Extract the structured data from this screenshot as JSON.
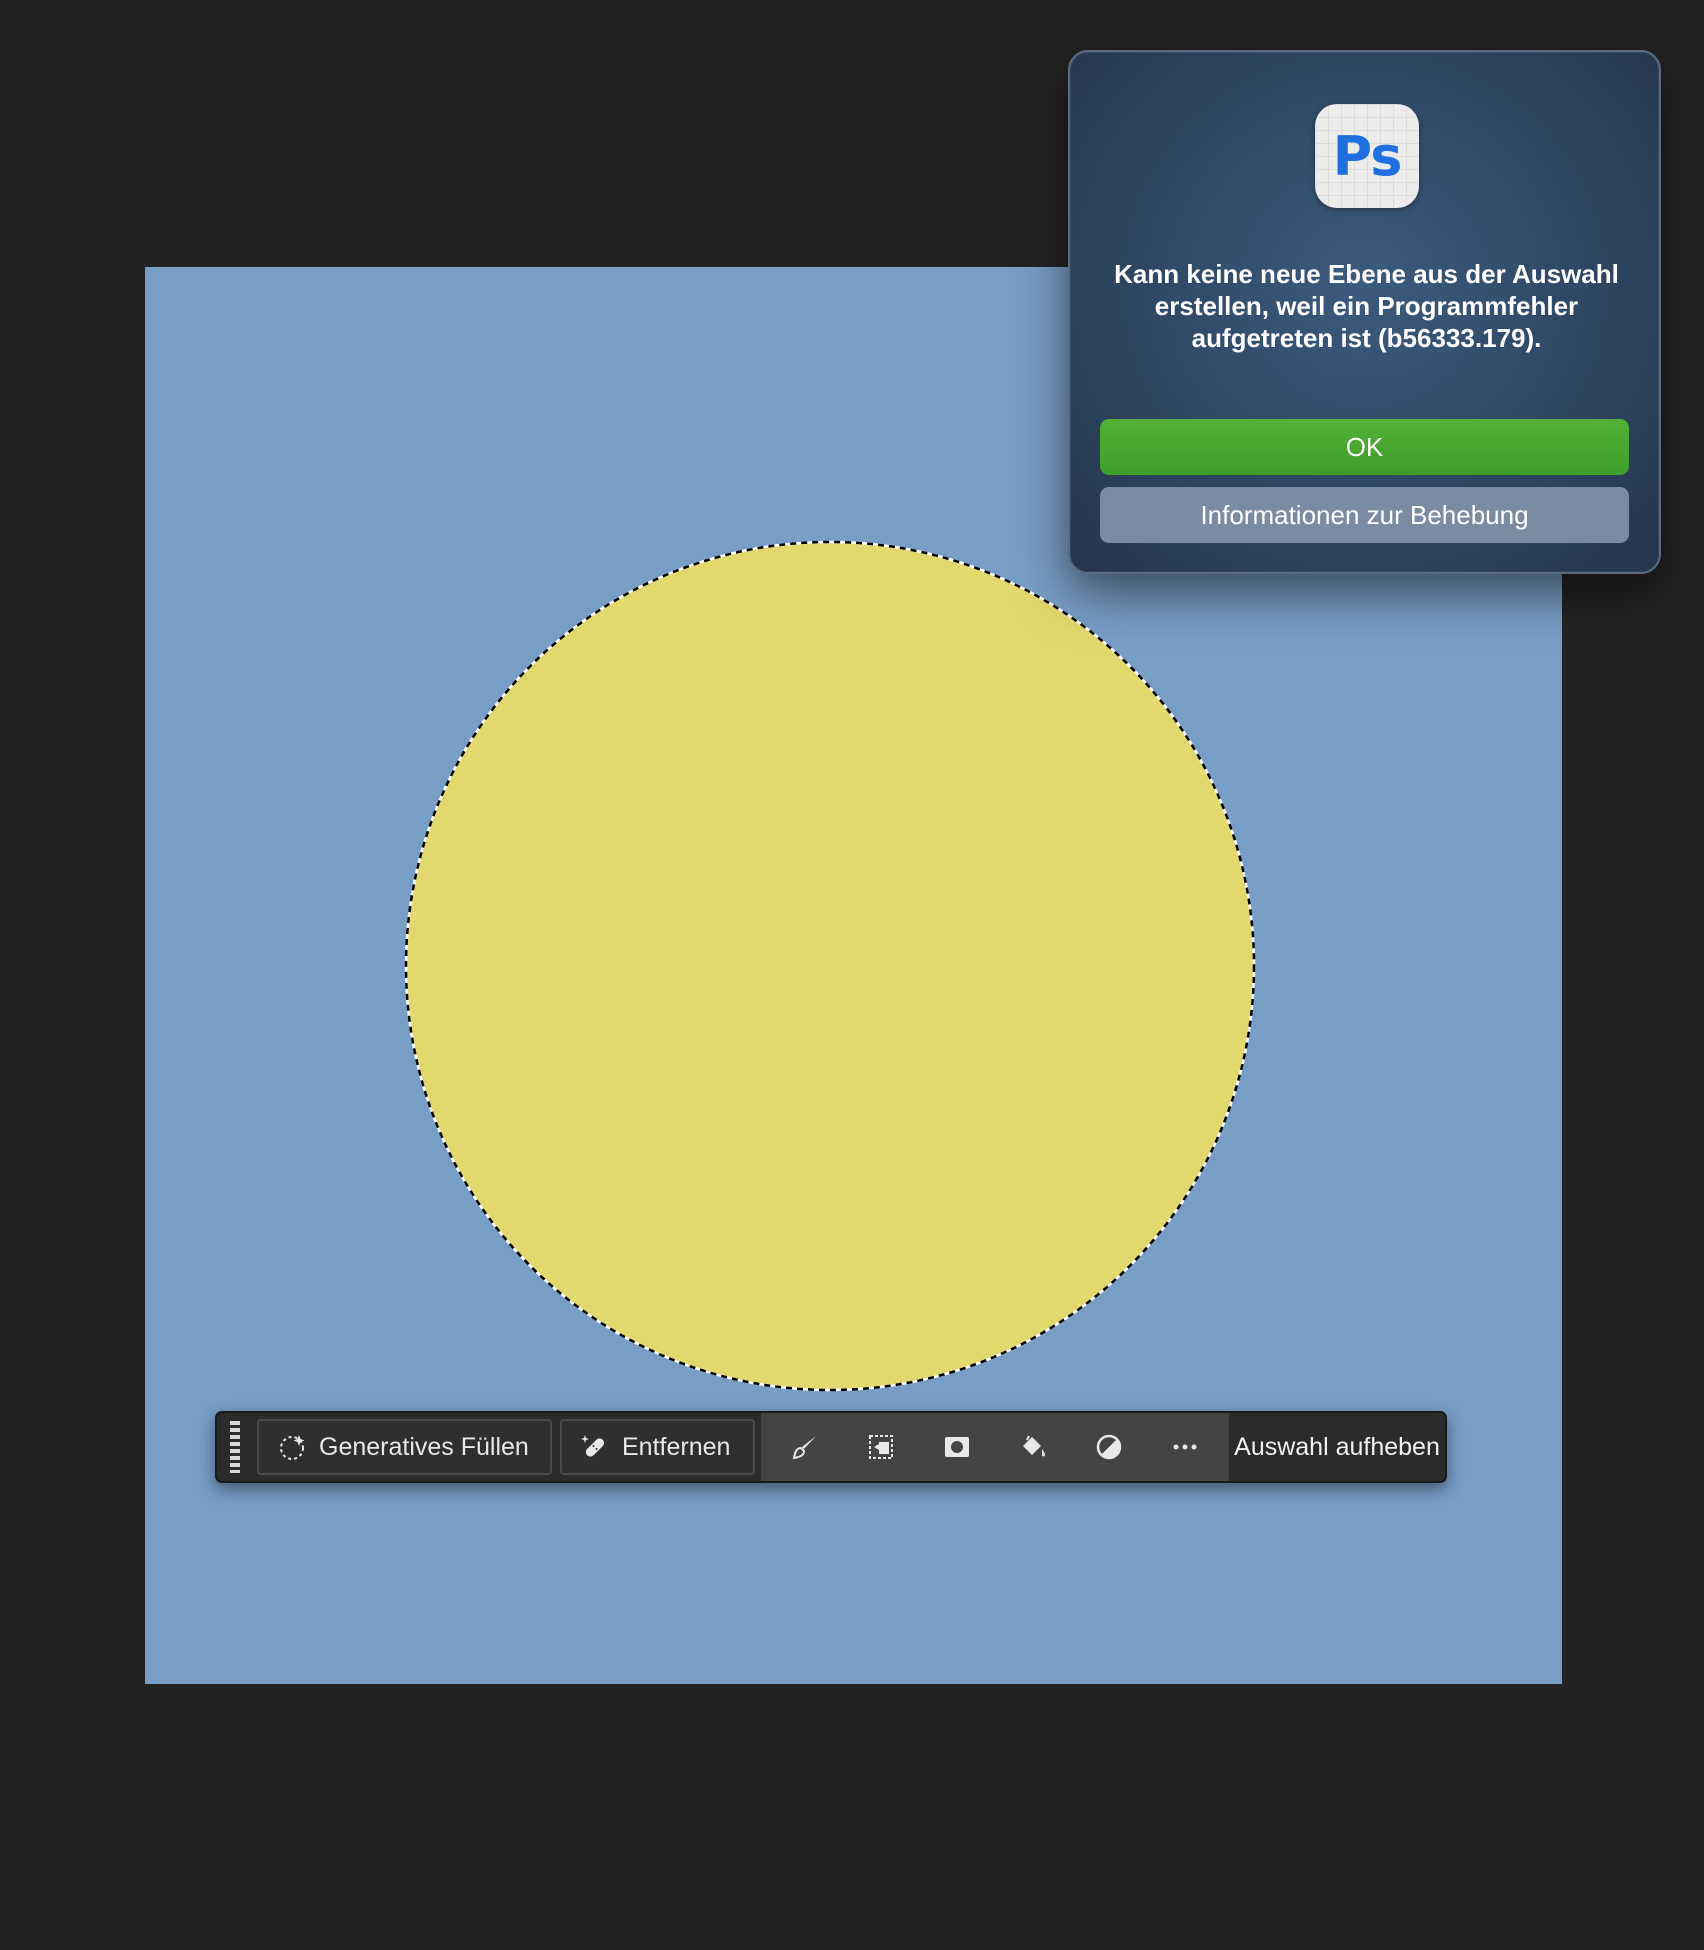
{
  "colors": {
    "workspace_bg": "#232323",
    "canvas_bg": "#789ec6",
    "circle_fill": "#e2d96e",
    "ok_button": "#4aa630",
    "secondary_button": "#7a8ca2",
    "ps_logo_blue": "#1f6fe0"
  },
  "dialog": {
    "app_icon_text": "Ps",
    "message": "Kann keine neue Ebene aus der Auswahl erstellen, weil ein Programmfehler aufgetreten ist (b56333.179).",
    "ok_label": "OK",
    "info_label": "Informationen zur Behebung"
  },
  "taskbar": {
    "generative_fill_label": "Generatives Füllen",
    "remove_label": "Entfernen",
    "icons": [
      "brush-icon",
      "transform-selection-icon",
      "mask-icon",
      "fill-bucket-icon",
      "adjustment-icon",
      "more-icon"
    ],
    "deselect_label": "Auswahl aufheben"
  }
}
